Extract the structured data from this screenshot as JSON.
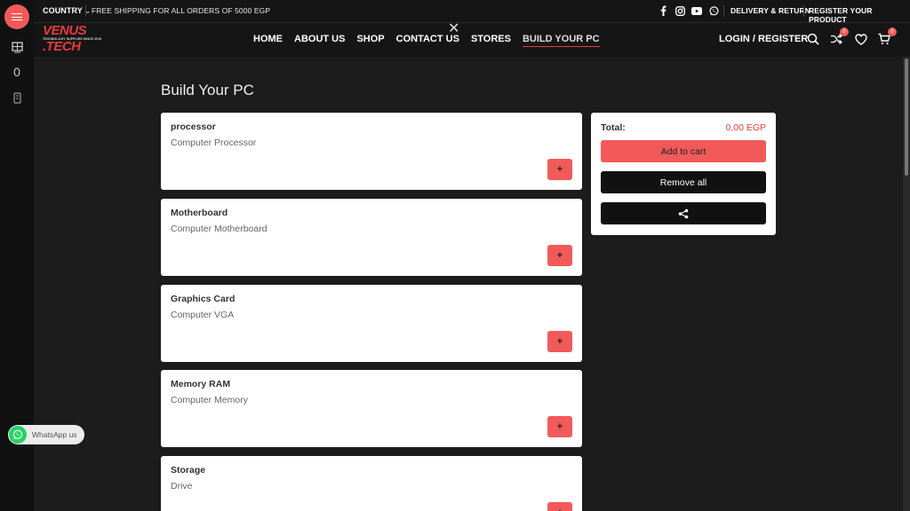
{
  "topbar": {
    "country": "COUNTRY",
    "country_caret": "⌄",
    "shipping": "FREE SHIPPING FOR ALL ORDERS OF 5000 EGP",
    "delivery": "DELIVERY & RETURN",
    "register_product": "REGISTER YOUR PRODUCT",
    "social_icons": [
      "facebook-icon",
      "instagram-icon",
      "youtube-icon",
      "whatsapp-icon"
    ]
  },
  "logo": {
    "line1": "VENUS",
    "tagline": "TECHNOLOGY SUPPLIES SINCE 2019",
    "line2": ".TECH"
  },
  "nav": {
    "items": [
      {
        "label": "HOME"
      },
      {
        "label": "ABOUT US"
      },
      {
        "label": "SHOP"
      },
      {
        "label": "CONTACT US"
      },
      {
        "label": "STORES"
      },
      {
        "label": "BUILD YOUR PC"
      }
    ],
    "active": "BUILD YOUR PC",
    "close": "✕"
  },
  "header": {
    "login": "LOGIN / REGISTER",
    "compare_count": "0",
    "cart_count": "0"
  },
  "rail": {
    "count": "0"
  },
  "page": {
    "title": "Build Your PC"
  },
  "components": [
    {
      "name": "processor",
      "desc": "Computer Processor",
      "add": "+"
    },
    {
      "name": "Motherboard",
      "desc": "Computer Motherboard",
      "add": "+"
    },
    {
      "name": "Graphics Card",
      "desc": "Computer VGA",
      "add": "+"
    },
    {
      "name": "Memory RAM",
      "desc": "Computer Memory",
      "add": "+"
    },
    {
      "name": "Storage",
      "desc": "Drive",
      "add": "+"
    }
  ],
  "summary": {
    "total_label": "Total:",
    "total_value": "0,00 EGP",
    "add_to_cart": "Add to cart",
    "remove_all": "Remove all"
  },
  "whatsapp": {
    "label": "WhatsApp us"
  },
  "colors": {
    "accent": "#f25a5a",
    "background": "#1c1c1c",
    "bar": "#151515"
  }
}
